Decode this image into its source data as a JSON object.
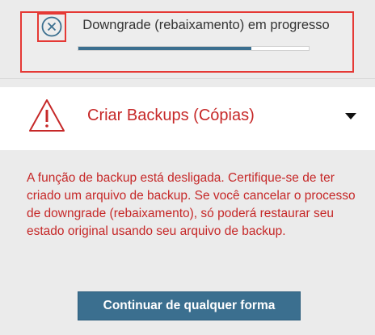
{
  "status": {
    "text": "Downgrade (rebaixamento) em progresso",
    "progress": 0.75,
    "cancel_icon": "cancel-circle-icon"
  },
  "section": {
    "title": "Criar Backups (Cópias)",
    "warning_icon": "warning-triangle-icon",
    "toggle_icon": "caret-down-icon"
  },
  "content": {
    "warning_text": "A função de backup está desligada. Certifique-se de ter criado um arquivo de backup. Se você cancelar o processo de downgrade (rebaixamento), só poderá restaurar seu estado original usando seu arquivo de backup.",
    "continue_label": "Continuar de qualquer forma"
  },
  "colors": {
    "accent": "#3b6f8f",
    "warning": "#c62828",
    "highlight": "#e53935"
  }
}
